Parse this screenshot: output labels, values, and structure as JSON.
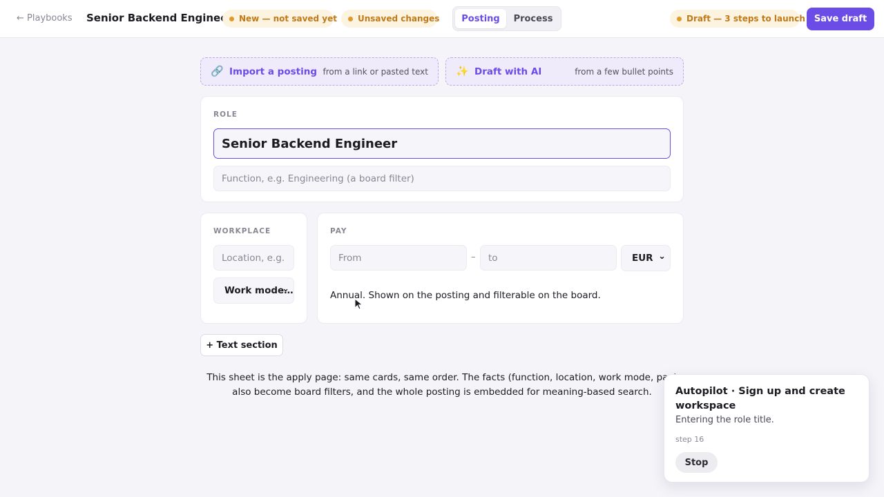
{
  "header": {
    "back_label": "← Playbooks",
    "title": "Senior Backend Engineer",
    "status_new": "New — not saved yet",
    "status_unsaved": "Unsaved changes",
    "tabs": [
      {
        "label": "Posting",
        "active": true
      },
      {
        "label": "Process",
        "active": false
      }
    ],
    "draft_status": "Draft — 3 steps to launch",
    "save_label": "Save draft"
  },
  "actions": {
    "import": {
      "icon": "link-icon",
      "title": "Import a posting",
      "subtitle": "from a link or pasted text"
    },
    "ai": {
      "icon": "sparkles-icon",
      "title": "Draft with AI",
      "subtitle": "from a few bullet points"
    }
  },
  "role": {
    "label": "ROLE",
    "title_value": "Senior Backend Engineer",
    "function_placeholder": "Function, e.g. Engineering (a board filter)"
  },
  "workplace": {
    "label": "WORKPLACE",
    "location_placeholder": "Location, e.g.",
    "work_mode_value": "Work mode…"
  },
  "pay": {
    "label": "PAY",
    "from_placeholder": "From",
    "separator": "–",
    "to_placeholder": "to",
    "currency": "EUR",
    "note": "Annual. Shown on the posting and filterable on the board."
  },
  "add_section_label": "+ Text section",
  "footnote": "This sheet is the apply page: same cards, same order. The facts (function, location, work mode, pay) also become board filters, and the whole posting is embedded for meaning-based search.",
  "autopilot": {
    "title": "Autopilot · Sign up and create workspace",
    "message": "Entering the role title.",
    "step": "step 16",
    "stop_label": "Stop"
  },
  "colors": {
    "accent": "#6b4ce6",
    "warning_bg": "#fdf3e1",
    "warning_text": "#c07a17",
    "page_bg": "#f5f4f9"
  }
}
